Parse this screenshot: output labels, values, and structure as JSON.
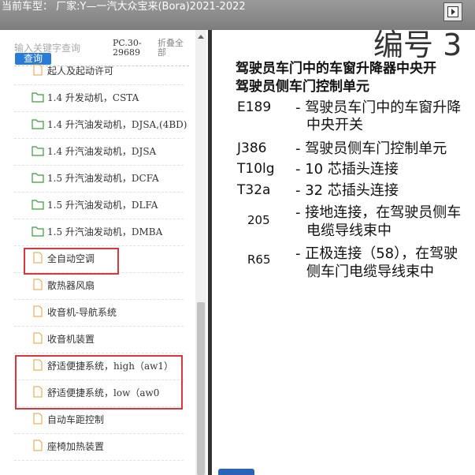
{
  "window": {
    "title": "当前车型： 厂家:Y—一汽大众宝来(Bora)2021-2022"
  },
  "sidebar": {
    "search": {
      "placeholder": "输入关键字查询",
      "button_label": "查询"
    },
    "pc_code": "PC.30-29689",
    "collapse_all_label": "折叠全部",
    "items": [
      {
        "label": "起人及起动许可",
        "icon": "file-icon"
      },
      {
        "label": "1.4 升发动机，CSTA",
        "icon": "folder-icon"
      },
      {
        "label": "1.4 升汽油发动机，DJSA,(4BD)",
        "icon": "folder-icon"
      },
      {
        "label": "1.4 升汽油发动机，DJSA",
        "icon": "folder-icon"
      },
      {
        "label": "1.5 升汽油发动机，DCFA",
        "icon": "folder-icon"
      },
      {
        "label": "1.5 升汽油发动机，DLFA",
        "icon": "folder-icon"
      },
      {
        "label": "1.5 升汽油发动机，DMBA",
        "icon": "folder-icon"
      },
      {
        "label": "全自动空调",
        "icon": "file-icon"
      },
      {
        "label": "散热器风扇",
        "icon": "file-icon"
      },
      {
        "label": "收音机-导航系统",
        "icon": "file-icon"
      },
      {
        "label": "收音机装置",
        "icon": "file-icon"
      },
      {
        "label": "舒适便捷系统，high（aw1）",
        "icon": "file-icon"
      },
      {
        "label": "舒适便捷系统，low（aw0",
        "icon": "file-icon"
      },
      {
        "label": "自动车距控制",
        "icon": "file-icon"
      },
      {
        "label": "座椅加热装置",
        "icon": "file-icon"
      }
    ]
  },
  "document": {
    "number_heading": "编号 3",
    "subheading_1": "驾驶员车门中的车窗升降器中央开",
    "subheading_2": "驾驶员侧车门控制单元",
    "legend": [
      {
        "code": "E189",
        "desc_1": "- 驾驶员车门中的车窗升降",
        "desc_2": "中央开关"
      },
      {
        "code": "J386",
        "desc_1": "- 驾驶员侧车门控制单元",
        "desc_2": ""
      },
      {
        "code": "T10lg",
        "desc_1": "- 10 芯插头连接",
        "desc_2": ""
      },
      {
        "code": "T32a",
        "desc_1": "- 32 芯插头连接",
        "desc_2": ""
      },
      {
        "code": "205",
        "desc_1": "- 接地连接，在驾驶员侧车",
        "desc_2": "电缆导线束中"
      },
      {
        "code": "R65",
        "desc_1": "- 正极连接（58），在驾驶",
        "desc_2": "侧车门电缆导线束中"
      }
    ]
  },
  "colors": {
    "highlight_box": "#d9363e",
    "accent_blue": "#2a7bd6",
    "folder_green": "#3c9a3c",
    "file_orange": "#e6a23c"
  }
}
